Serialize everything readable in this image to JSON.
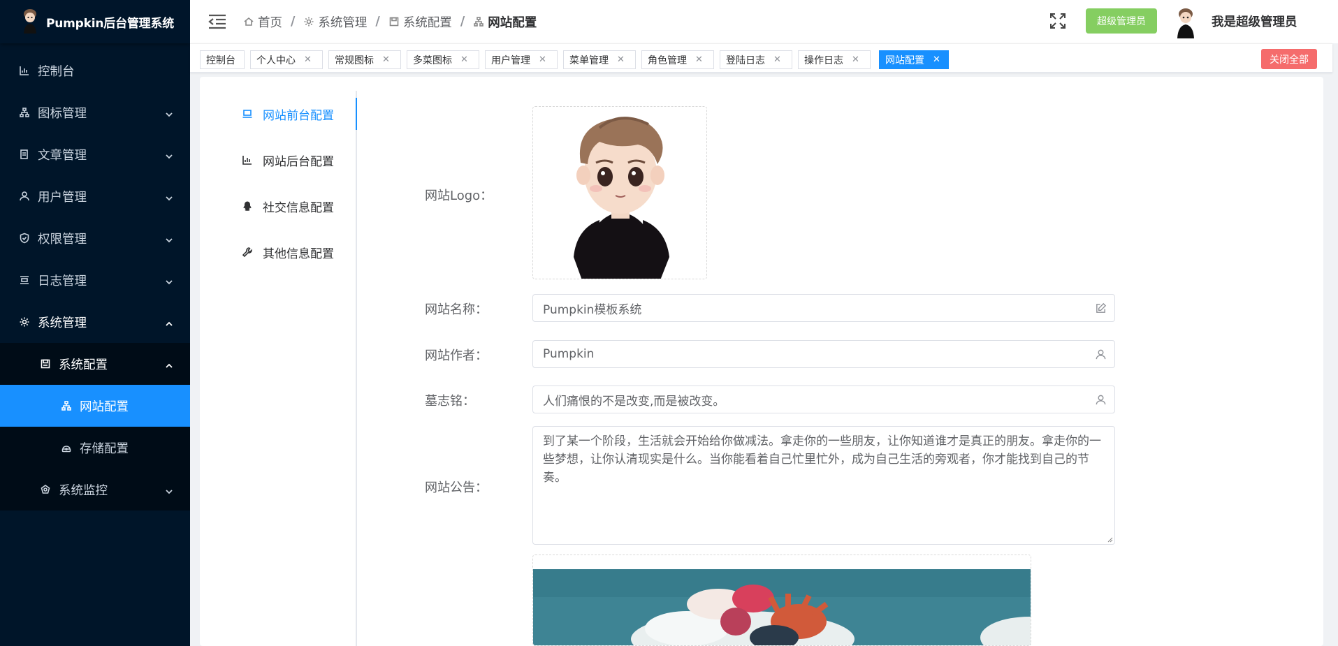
{
  "brand": {
    "title": "Pumpkin后台管理系统"
  },
  "sidebar": {
    "items": [
      {
        "label": "控制台",
        "icon": "bar-chart-icon"
      },
      {
        "label": "图标管理",
        "icon": "sitemap-icon"
      },
      {
        "label": "文章管理",
        "icon": "document-icon"
      },
      {
        "label": "用户管理",
        "icon": "user-icon"
      },
      {
        "label": "权限管理",
        "icon": "shield-icon"
      },
      {
        "label": "日志管理",
        "icon": "log-icon"
      },
      {
        "label": "系统管理",
        "icon": "gear-icon"
      }
    ],
    "sub": {
      "label": "系统配置",
      "icon": "save-icon"
    },
    "subsub": [
      {
        "label": "网站配置",
        "icon": "sitemap-icon"
      },
      {
        "label": "存储配置",
        "icon": "storage-icon"
      }
    ],
    "monitor": {
      "label": "系统监控",
      "icon": "monitor-icon"
    }
  },
  "header": {
    "breadcrumb": [
      "首页",
      "系统管理",
      "系统配置",
      "网站配置"
    ],
    "role_badge": "超级管理员",
    "user_name": "我是超级管理员"
  },
  "tabs": [
    "控制台",
    "个人中心",
    "常规图标",
    "多菜图标",
    "用户管理",
    "菜单管理",
    "角色管理",
    "登陆日志",
    "操作日志",
    "网站配置"
  ],
  "tabs_close_all": "关闭全部",
  "side_tabs": [
    "网站前台配置",
    "网站后台配置",
    "社交信息配置",
    "其他信息配置"
  ],
  "form": {
    "logo_label": "网站Logo：",
    "name_label": "网站名称：",
    "name_value": "Pumpkin模板系统",
    "author_label": "网站作者：",
    "author_value": "Pumpkin",
    "motto_label": "墓志铭：",
    "motto_value": "人们痛恨的不是改变,而是被改变。",
    "notice_label": "网站公告：",
    "notice_value": "到了某一个阶段，生活就会开始给你做减法。拿走你的一些朋友，让你知道谁才是真正的朋友。拿走你的一些梦想，让你认清现实是什么。当你能看着自己忙里忙外，成为自己生活的旁观者，你才能找到自己的节奏。"
  },
  "colors": {
    "sidebar_bg": "#001529",
    "accent": "#1890ff",
    "role_badge": "#85ce61",
    "close_all": "#f56c6c"
  }
}
